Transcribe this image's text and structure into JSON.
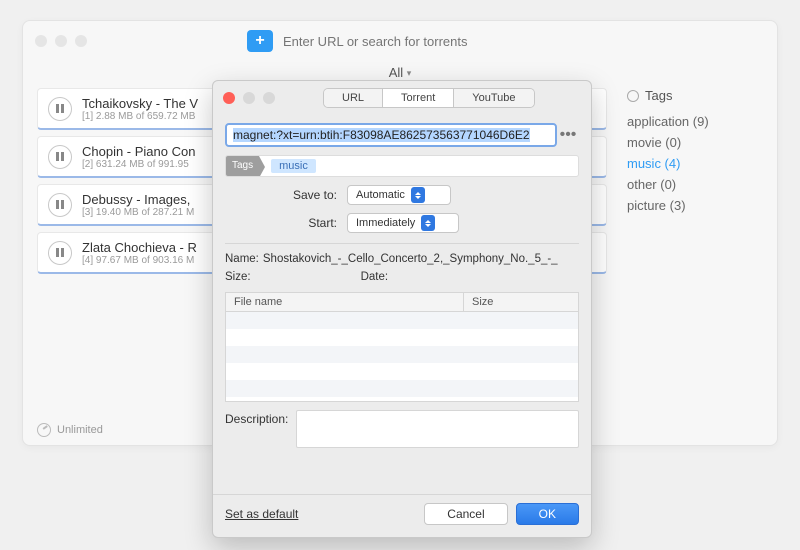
{
  "header": {
    "search_placeholder": "Enter URL or search for torrents",
    "filter_label": "All"
  },
  "downloads": [
    {
      "title": "Tchaikovsky - The V",
      "index": "[1]",
      "progress": "2.88 MB of 659.72 MB"
    },
    {
      "title": "Chopin - Piano Con",
      "index": "[2]",
      "progress": "631.24 MB of 991.95"
    },
    {
      "title": "Debussy  - Images,",
      "index": "[3]",
      "progress": "19.40 MB of 287.21 M"
    },
    {
      "title": "Zlata Chochieva - R",
      "index": "[4]",
      "progress": "97.67 MB of 903.16 M"
    }
  ],
  "sidebar": {
    "title": "Tags",
    "tags": [
      {
        "label": "application (9)",
        "active": false
      },
      {
        "label": "movie (0)",
        "active": false
      },
      {
        "label": "music (4)",
        "active": true
      },
      {
        "label": "other (0)",
        "active": false
      },
      {
        "label": "picture (3)",
        "active": false
      }
    ]
  },
  "footer": {
    "status": "Unlimited"
  },
  "modal": {
    "tabs": {
      "url": "URL",
      "torrent": "Torrent",
      "youtube": "YouTube"
    },
    "magnet": "magnet:?xt=urn:btih:F83098AE862573563771046D6E2",
    "tags_label": "Tags",
    "tag_chip": "music",
    "save_to": {
      "label": "Save to:",
      "value": "Automatic"
    },
    "start": {
      "label": "Start:",
      "value": "Immediately"
    },
    "name": {
      "label": "Name:",
      "value": "Shostakovich_-_Cello_Concerto_2,_Symphony_No._5_-_"
    },
    "size_label": "Size:",
    "date_label": "Date:",
    "table": {
      "col_file": "File name",
      "col_size": "Size"
    },
    "description_label": "Description:",
    "set_default": "Set as default",
    "cancel": "Cancel",
    "ok": "OK"
  }
}
